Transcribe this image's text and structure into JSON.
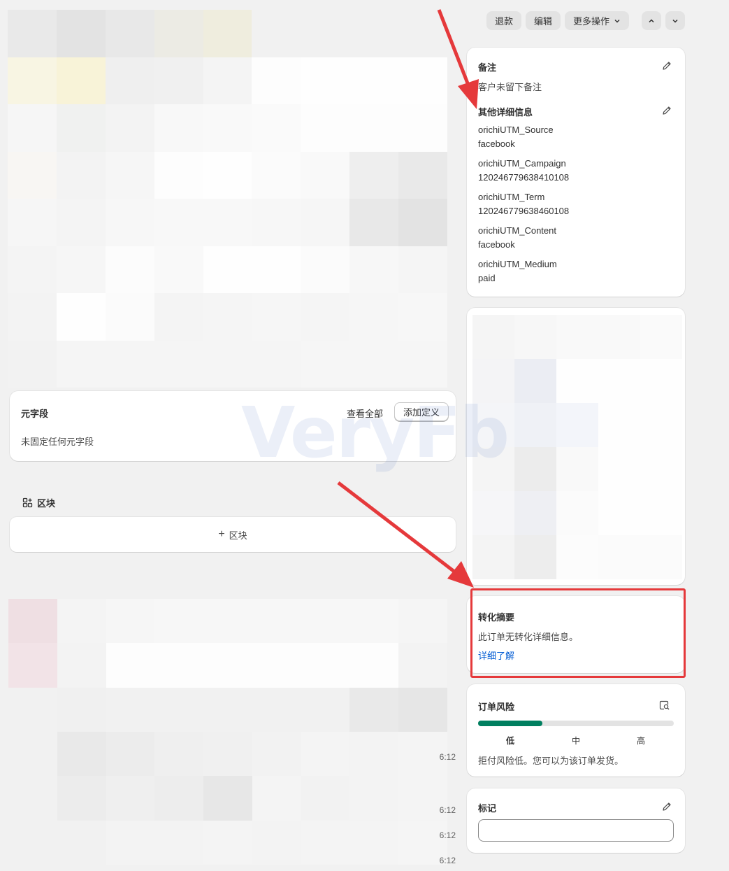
{
  "toolbar": {
    "refund_label": "退款",
    "edit_label": "编辑",
    "more_actions_label": "更多操作"
  },
  "notes_card": {
    "title": "备注",
    "empty_text": "客户未留下备注",
    "details_title": "其他详细信息",
    "details": [
      {
        "key": "orichiUTM_Source",
        "value": "facebook"
      },
      {
        "key": "orichiUTM_Campaign",
        "value": "120246779638410108"
      },
      {
        "key": "orichiUTM_Term",
        "value": "120246779638460108"
      },
      {
        "key": "orichiUTM_Content",
        "value": "facebook"
      },
      {
        "key": "orichiUTM_Medium",
        "value": "paid"
      }
    ]
  },
  "metafields_card": {
    "title": "元字段",
    "view_all": "查看全部",
    "add_definition": "添加定义",
    "empty_text": "未固定任何元字段"
  },
  "blocks": {
    "heading": "区块",
    "add_button": "区块"
  },
  "conversion_card": {
    "title": "转化摘要",
    "text": "此订单无转化详细信息。",
    "link": "详细了解"
  },
  "risk_card": {
    "title": "订单风险",
    "level_fraction": 0.33,
    "labels": [
      "低",
      "中",
      "高"
    ],
    "text": "拒付风险低。您可以为该订单发货。",
    "fill_color": "#007f5f"
  },
  "tags_card": {
    "title": "标记",
    "input_value": ""
  },
  "timeline": {
    "times": [
      "6:12",
      "6:12",
      "6:12",
      "6:12"
    ]
  },
  "watermark": "VeryFb",
  "annotation_color": "#e5393b"
}
